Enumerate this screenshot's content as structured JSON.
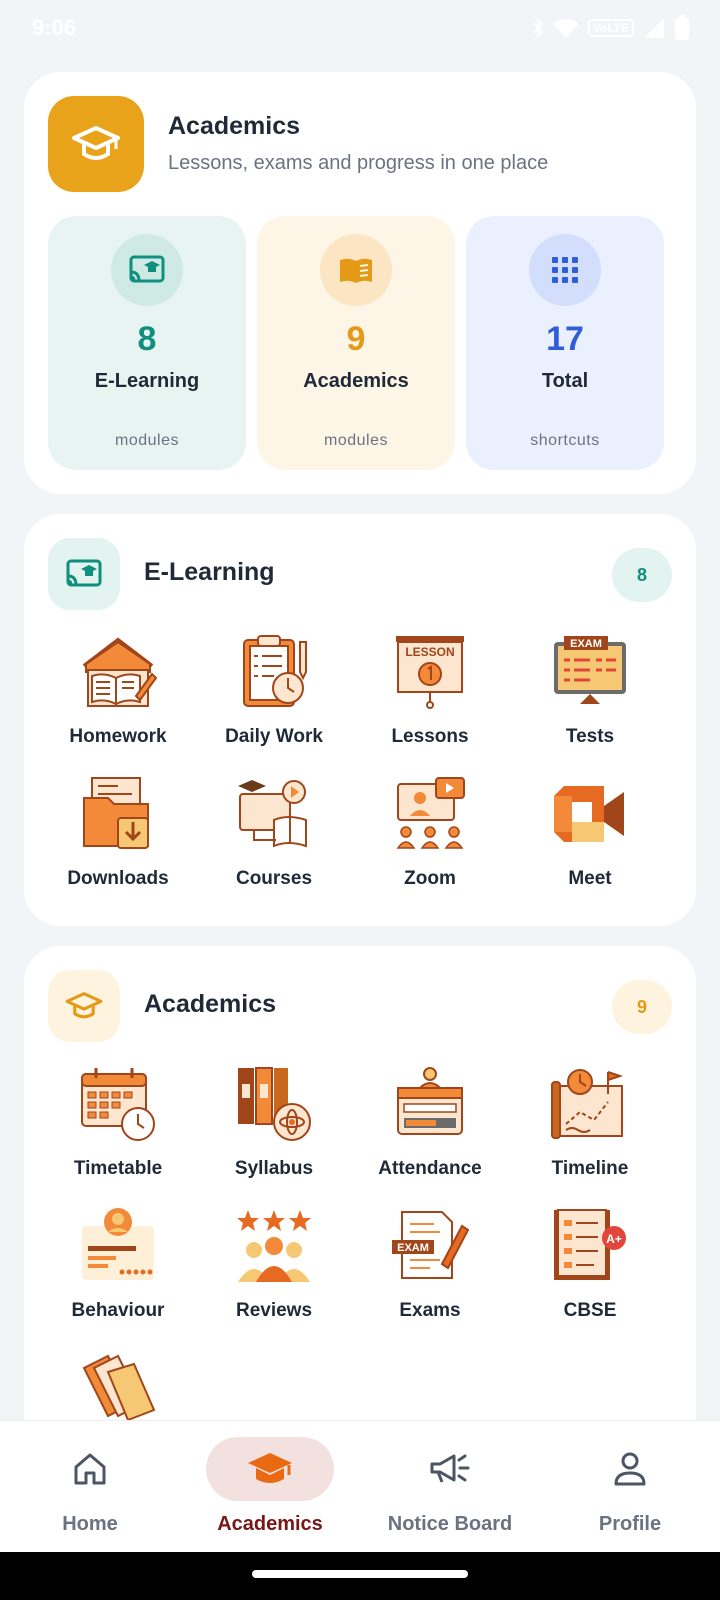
{
  "status_bar": {
    "time": "9:06",
    "network": "VoLTE"
  },
  "summary": {
    "title": "Academics",
    "subtitle": "Lessons, exams and progress in one place",
    "stats": [
      {
        "value": "8",
        "label": "E-Learning",
        "unit": "modules",
        "color": "#0f8f7e"
      },
      {
        "value": "9",
        "label": "Academics",
        "unit": "modules",
        "color": "#e49a16"
      },
      {
        "value": "17",
        "label": "Total",
        "unit": "shortcuts",
        "color": "#2f5ed8"
      }
    ]
  },
  "elearning": {
    "title": "E-Learning",
    "badge": "8",
    "items": [
      {
        "label": "Homework",
        "icon": "homework-icon"
      },
      {
        "label": "Daily Work",
        "icon": "clipboard-timer-icon"
      },
      {
        "label": "Lessons",
        "icon": "lesson-board-icon",
        "board_text": "LESSON"
      },
      {
        "label": "Tests",
        "icon": "exam-screen-icon",
        "board_text": "EXAM"
      },
      {
        "label": "Downloads",
        "icon": "download-folder-icon"
      },
      {
        "label": "Courses",
        "icon": "online-course-icon"
      },
      {
        "label": "Zoom",
        "icon": "video-conference-icon"
      },
      {
        "label": "Meet",
        "icon": "meet-camera-icon"
      }
    ]
  },
  "academics": {
    "title": "Academics",
    "badge": "9",
    "items": [
      {
        "label": "Timetable",
        "icon": "calendar-clock-icon"
      },
      {
        "label": "Syllabus",
        "icon": "books-atom-icon"
      },
      {
        "label": "Attendance",
        "icon": "attendance-desk-icon"
      },
      {
        "label": "Timeline",
        "icon": "timeline-map-icon"
      },
      {
        "label": "Behaviour",
        "icon": "behaviour-card-icon"
      },
      {
        "label": "Reviews",
        "icon": "star-reviews-icon"
      },
      {
        "label": "Exams",
        "icon": "exam-paper-icon",
        "board_text": "EXAM"
      },
      {
        "label": "CBSE",
        "icon": "checklist-grade-icon",
        "board_text": "A+"
      },
      {
        "label": "",
        "icon": "folders-icon"
      }
    ]
  },
  "nav": {
    "items": [
      {
        "label": "Home",
        "icon": "home-icon",
        "active": false
      },
      {
        "label": "Academics",
        "icon": "graduation-cap-icon",
        "active": true
      },
      {
        "label": "Notice Board",
        "icon": "megaphone-icon",
        "active": false
      },
      {
        "label": "Profile",
        "icon": "person-icon",
        "active": false
      }
    ]
  },
  "colors": {
    "accent_orange": "#e9a31b",
    "teal": "#0f8f7e",
    "blue": "#2f5ed8",
    "nav_active": "#7a1616",
    "icon_orange": "#f28a3a",
    "icon_outline": "#a0461a"
  }
}
